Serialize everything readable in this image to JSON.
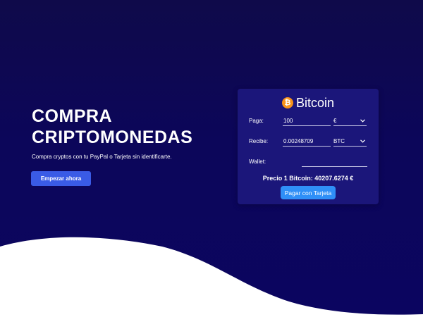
{
  "hero": {
    "title_line1": "COMPRA",
    "title_line2": "CRIPTOMONEDAS",
    "subtitle": "Compra cryptos con tu PayPal o Tarjeta sin identificarte.",
    "cta_label": "Empezar ahora"
  },
  "widget": {
    "coin_symbol": "₿",
    "title": "Bitcoin",
    "pay_label": "Paga:",
    "pay_amount": "100",
    "pay_currency": "€",
    "receive_label": "Recibe:",
    "receive_amount": "0.00248709",
    "receive_currency": "BTC",
    "wallet_label": "Wallet:",
    "wallet_value": "",
    "price_text": "Precio 1 Bitcoin: 40207.6274 €",
    "pay_button_label": "Pagar con Tarjeta"
  },
  "icons": {
    "coin": "bitcoin-icon",
    "dropdown": "chevron-down-icon"
  },
  "colors": {
    "background": "#0c065a",
    "card": "#1b167a",
    "cta": "#3a5be6",
    "pay_button": "#2f8ff7",
    "bitcoin_orange": "#f7931a",
    "wave": "#ffffff"
  }
}
